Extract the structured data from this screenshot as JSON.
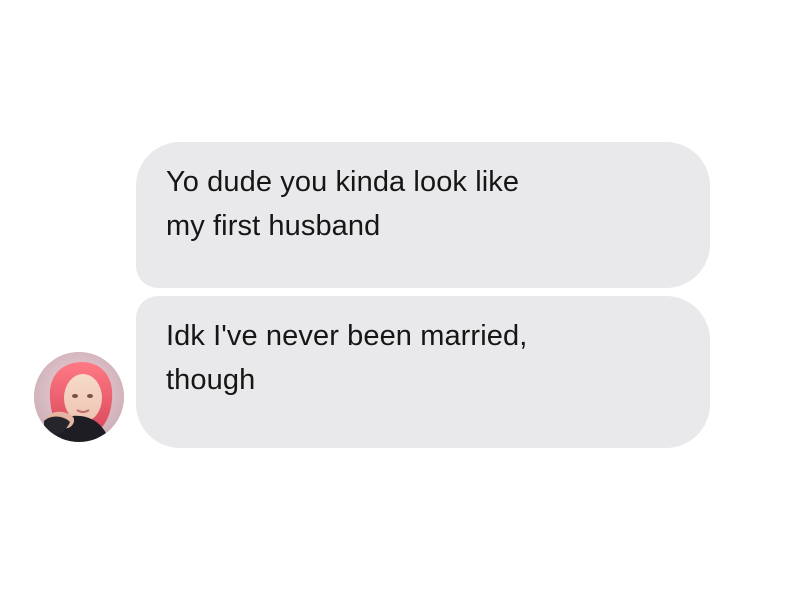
{
  "messages": [
    {
      "text": "Yo dude you kinda look like\nmy first husband",
      "direction": "incoming"
    },
    {
      "text": "Idk I've never been married,\nthough",
      "direction": "incoming"
    }
  ],
  "colors": {
    "background": "#ffffff",
    "bubble": "#e9e9eb",
    "text": "#161616"
  },
  "sender": {
    "avatar_icon": "profile-photo-avatar"
  }
}
